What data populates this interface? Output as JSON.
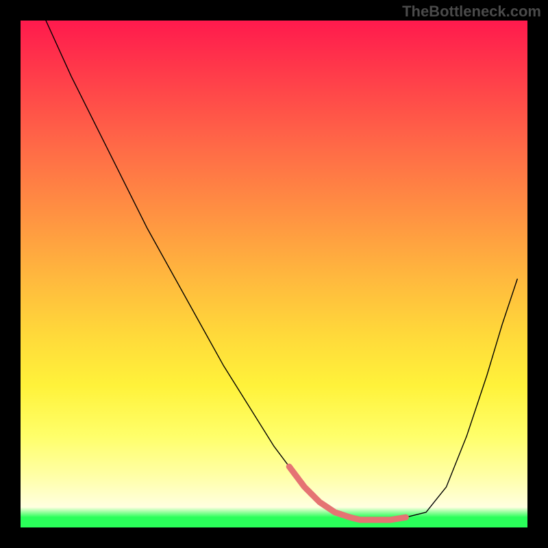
{
  "watermark": "TheBottleneck.com",
  "chart_data": {
    "type": "line",
    "title": "",
    "xlabel": "",
    "ylabel": "",
    "xlim": [
      0,
      100
    ],
    "ylim": [
      0,
      100
    ],
    "grid": false,
    "legend": false,
    "series": [
      {
        "name": "black-curve",
        "stroke": "#000000",
        "x": [
          5,
          10,
          15,
          20,
          25,
          30,
          35,
          40,
          45,
          50,
          53,
          56,
          59,
          62,
          65,
          67,
          70,
          73,
          76,
          80,
          84,
          88,
          92,
          95,
          98
        ],
        "values": [
          100,
          89,
          79,
          69,
          59,
          50,
          41,
          32,
          24,
          16,
          12,
          8,
          5,
          3,
          2,
          1.5,
          1.5,
          1.5,
          2,
          3,
          8,
          18,
          30,
          40,
          49
        ]
      },
      {
        "name": "pink-highlight",
        "stroke": "#e57373",
        "stroke_width": 9,
        "x": [
          53,
          56,
          59,
          62,
          65,
          67,
          70,
          73,
          76
        ],
        "values": [
          12,
          8,
          5,
          3,
          2,
          1.5,
          1.5,
          1.5,
          2
        ]
      }
    ],
    "background_gradient": {
      "top": "#ff1a4d",
      "middle": "#ffd93a",
      "bottom_band": "#2aff5a"
    }
  }
}
